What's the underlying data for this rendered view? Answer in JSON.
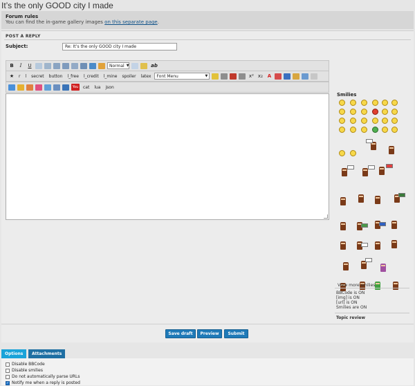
{
  "page": {
    "title": "It’s the only GOOD city I made"
  },
  "rules": {
    "heading": "Forum rules",
    "text_before": "You can find the in-game gallery images ",
    "link": "on this separate page",
    "text_after": "."
  },
  "form": {
    "section": "POST A REPLY",
    "subject_label": "Subject:",
    "subject_value": "Re: It’s the only GOOD city I made"
  },
  "toolbar": {
    "row1": {
      "bold": "B",
      "italic": "I",
      "underline": "U",
      "ab": "ab",
      "font_size": "Normal"
    },
    "row2": {
      "star": "★",
      "r": "r",
      "l": "l",
      "secret": "secret",
      "button": "button",
      "l_free": "l_free",
      "l_credit": "l_credit",
      "l_mine": "l_mine",
      "spoiler": "spoiler",
      "latex": "latex",
      "font_menu": "Font Menu",
      "superscript": "x²",
      "subscript": "x₂",
      "a": "A"
    },
    "row3": {
      "cat": "cat",
      "lua": "lua",
      "json": "json",
      "tube": "You"
    }
  },
  "sidebar": {
    "smilies_title": "Smilies",
    "view_more": "View more smilies",
    "bbcode": "BBCode is ON",
    "img": "[img] is ON",
    "url": "[url] is ON",
    "smilies_status": "Smilies are ON",
    "topic_review": "Topic review"
  },
  "actions": {
    "save_draft": "Save draft",
    "preview": "Preview",
    "submit": "Submit"
  },
  "tabs": {
    "options": "Options",
    "attachments": "Attachments"
  },
  "options": [
    {
      "label": "Disable BBCode",
      "checked": false
    },
    {
      "label": "Disable smilies",
      "checked": false
    },
    {
      "label": "Do not automatically parse URLs",
      "checked": false
    },
    {
      "label": "Notify me when a reply is posted",
      "checked": true
    }
  ]
}
